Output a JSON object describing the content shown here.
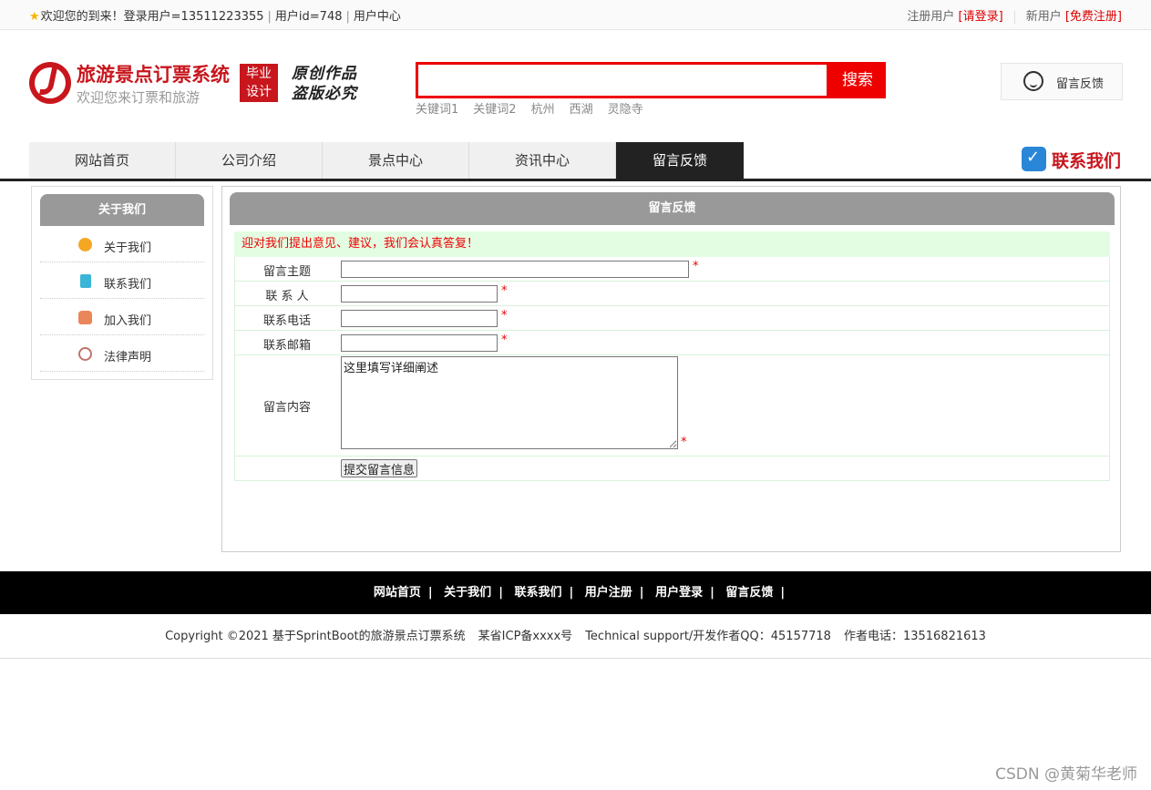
{
  "topbar": {
    "welcome": "欢迎您的到来！登录用户=13511223355",
    "user_id": "用户id=748",
    "user_center": "用户中心",
    "register_user": "注册用户",
    "login_link": "[请登录]",
    "new_user": "新用户",
    "free_register": "[免费注册]"
  },
  "header": {
    "title": "旅游景点订票系统",
    "subtitle": "欢迎您来订票和旅游",
    "badge": [
      "毕业",
      "设计"
    ],
    "slogan": [
      "原创作品",
      "盗版必究"
    ],
    "search_placeholder": "",
    "search_button": "搜索",
    "keywords": [
      "关键词1",
      "关键词2",
      "杭州",
      "西湖",
      "灵隐寺"
    ],
    "feedback": "留言反馈"
  },
  "nav": {
    "items": [
      "网站首页",
      "公司介绍",
      "景点中心",
      "资讯中心",
      "留言反馈"
    ],
    "active_index": 4,
    "contact": "联系我们"
  },
  "sidebar": {
    "title": "关于我们",
    "items": [
      {
        "label": "关于我们",
        "icon": "smile-icon",
        "color": "#f5a623"
      },
      {
        "label": "联系我们",
        "icon": "clipboard-icon",
        "color": "#39b5d6"
      },
      {
        "label": "加入我们",
        "icon": "lock-icon",
        "color": "#e9865a"
      },
      {
        "label": "法律声明",
        "icon": "power-icon",
        "color": "#c0726a"
      }
    ]
  },
  "main": {
    "title": "留言反馈",
    "notice": "迎对我们提出意见、建议，我们会认真答复！",
    "form": {
      "subject_label": "留言主题",
      "contact_label": "联 系 人",
      "phone_label": "联系电话",
      "email_label": "联系邮箱",
      "content_label": "留言内容",
      "content_value": "这里填写详细阐述",
      "required_mark": "*",
      "submit": "提交留言信息"
    }
  },
  "footer": {
    "links": [
      "网站首页",
      "关于我们",
      "联系我们",
      "用户注册",
      "用户登录",
      "留言反馈"
    ],
    "copyright": "Copyright ©2021 基于SprintBoot的旅游景点订票系统",
    "icp": "某省ICP备xxxx号",
    "support": "Technical support/开发作者QQ：45157718",
    "phone": "作者电话：13516821613"
  },
  "watermark": "CSDN @黄菊华老师",
  "colors": {
    "brand_red": "#c8161d",
    "search_red": "#e00000",
    "nav_active": "#222222",
    "panel_head": "#999999",
    "notice_bg": "#e3fde3"
  }
}
